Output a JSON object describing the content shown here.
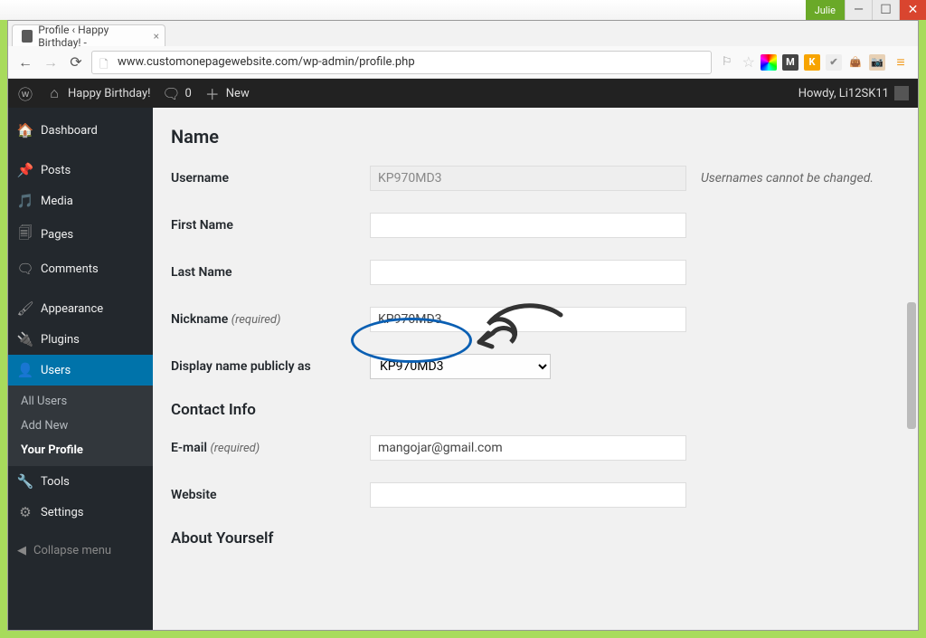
{
  "window": {
    "user": "Julie"
  },
  "browser": {
    "tab_title": "Profile ‹ Happy Birthday! -",
    "url": "www.customonepagewebsite.com/wp-admin/profile.php"
  },
  "adminbar": {
    "site_title": "Happy Birthday!",
    "comments_count": "0",
    "new_label": "New",
    "howdy": "Howdy, Li12SK11"
  },
  "sidebar": {
    "items": [
      {
        "label": "Dashboard",
        "icon": "dashboard"
      },
      {
        "label": "Posts",
        "icon": "posts"
      },
      {
        "label": "Media",
        "icon": "media"
      },
      {
        "label": "Pages",
        "icon": "pages"
      },
      {
        "label": "Comments",
        "icon": "comments"
      },
      {
        "label": "Appearance",
        "icon": "appearance"
      },
      {
        "label": "Plugins",
        "icon": "plugins"
      },
      {
        "label": "Users",
        "icon": "users"
      },
      {
        "label": "Tools",
        "icon": "tools"
      },
      {
        "label": "Settings",
        "icon": "settings"
      }
    ],
    "users_submenu": [
      {
        "label": "All Users"
      },
      {
        "label": "Add New"
      },
      {
        "label": "Your Profile",
        "current": true
      }
    ],
    "collapse_label": "Collapse menu"
  },
  "content": {
    "heading_name": "Name",
    "heading_contact": "Contact Info",
    "heading_about": "About Yourself",
    "username_label": "Username",
    "username_value": "KP970MD3",
    "username_note": "Usernames cannot be changed.",
    "firstname_label": "First Name",
    "firstname_value": "",
    "lastname_label": "Last Name",
    "lastname_value": "",
    "nickname_label": "Nickname",
    "nickname_req": "(required)",
    "nickname_value": "KP970MD3",
    "display_label": "Display name publicly as",
    "display_value": "KP970MD3",
    "email_label": "E-mail",
    "email_req": "(required)",
    "email_value": "mangojar@gmail.com",
    "website_label": "Website",
    "website_value": ""
  }
}
